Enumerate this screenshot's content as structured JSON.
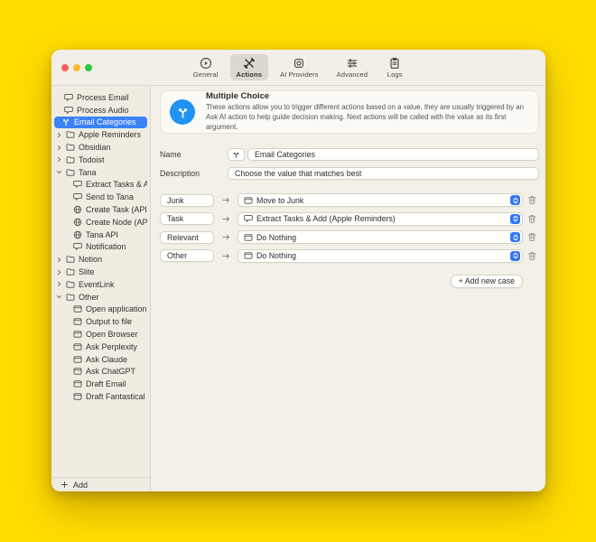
{
  "window": {
    "toolbar": {
      "tabs": [
        {
          "id": "general",
          "label": "General",
          "icon": "play-circle-icon",
          "selected": false
        },
        {
          "id": "actions",
          "label": "Actions",
          "icon": "tools-icon",
          "selected": true
        },
        {
          "id": "ai-providers",
          "label": "AI Providers",
          "icon": "chip-icon",
          "selected": false
        },
        {
          "id": "advanced",
          "label": "Advanced",
          "icon": "sliders-icon",
          "selected": false
        },
        {
          "id": "logs",
          "label": "Logs",
          "icon": "clipboard-icon",
          "selected": false
        }
      ]
    },
    "sidebar": {
      "items": [
        {
          "label": "Process Email",
          "icon": "bubble-icon",
          "type": "item",
          "selected": false
        },
        {
          "label": "Process Audio",
          "icon": "bubble-icon",
          "type": "item",
          "selected": false
        },
        {
          "label": "Email Categories",
          "icon": "branch-icon",
          "type": "item",
          "selected": true
        },
        {
          "label": "Apple Reminders",
          "icon": "folder-icon",
          "type": "folder",
          "expanded": false
        },
        {
          "label": "Obsidian",
          "icon": "folder-icon",
          "type": "folder",
          "expanded": false
        },
        {
          "label": "Todoist",
          "icon": "folder-icon",
          "type": "folder",
          "expanded": false
        },
        {
          "label": "Tana",
          "icon": "folder-icon",
          "type": "folder",
          "expanded": true
        },
        {
          "label": "Extract Tasks & Add",
          "icon": "bubble-icon",
          "type": "child",
          "selected": false
        },
        {
          "label": "Send to Tana",
          "icon": "bubble-icon",
          "type": "child",
          "selected": false
        },
        {
          "label": "Create Task (API)",
          "icon": "globe-icon",
          "type": "child",
          "selected": false
        },
        {
          "label": "Create Node (API)",
          "icon": "globe-icon",
          "type": "child",
          "selected": false
        },
        {
          "label": "Tana API",
          "icon": "globe-icon",
          "type": "child",
          "selected": false
        },
        {
          "label": "Notification",
          "icon": "bubble-icon",
          "type": "child",
          "selected": false
        },
        {
          "label": "Notion",
          "icon": "folder-icon",
          "type": "folder",
          "expanded": false
        },
        {
          "label": "Slite",
          "icon": "folder-icon",
          "type": "folder",
          "expanded": false
        },
        {
          "label": "EventLink",
          "icon": "folder-icon",
          "type": "folder",
          "expanded": false
        },
        {
          "label": "Other",
          "icon": "folder-icon",
          "type": "folder",
          "expanded": true
        },
        {
          "label": "Open application",
          "icon": "window-icon",
          "type": "child",
          "selected": false
        },
        {
          "label": "Output to file",
          "icon": "window-icon",
          "type": "child",
          "selected": false
        },
        {
          "label": "Open Browser",
          "icon": "window-icon",
          "type": "child",
          "selected": false
        },
        {
          "label": "Ask Perplexity",
          "icon": "window-icon",
          "type": "child",
          "selected": false
        },
        {
          "label": "Ask Claude",
          "icon": "window-icon",
          "type": "child",
          "selected": false
        },
        {
          "label": "Ask ChatGPT",
          "icon": "window-icon",
          "type": "child",
          "selected": false
        },
        {
          "label": "Draft Email",
          "icon": "window-icon",
          "type": "child",
          "selected": false
        },
        {
          "label": "Draft Fantastical Event",
          "icon": "window-icon",
          "type": "child",
          "selected": false
        }
      ],
      "add_button_label": "Add"
    },
    "content": {
      "header": {
        "title": "Multiple Choice",
        "description": "These actions allow you to trigger different actions based on a value, they are usually triggered by an Ask AI action to help guide decision making. Next actions will be called with the value as its first argument.",
        "icon": "branch-icon",
        "icon_color": "#1e93f4"
      },
      "fields": {
        "name_label": "Name",
        "name_value": "Email Categories",
        "description_label": "Description",
        "description_value": "Choose the value that matches best"
      },
      "cases": [
        {
          "value": "Junk",
          "action": "Move to Junk",
          "action_icon": "window-icon"
        },
        {
          "value": "Task",
          "action": "Extract Tasks & Add (Apple Reminders)",
          "action_icon": "bubble-icon"
        },
        {
          "value": "Relevant",
          "action": "Do Nothing",
          "action_icon": "window-icon"
        },
        {
          "value": "Other",
          "action": "Do Nothing",
          "action_icon": "window-icon"
        }
      ],
      "add_case_button_label": "+ Add new case"
    },
    "colors": {
      "accent": "#3478f6",
      "selection": "#3b82f7"
    }
  }
}
